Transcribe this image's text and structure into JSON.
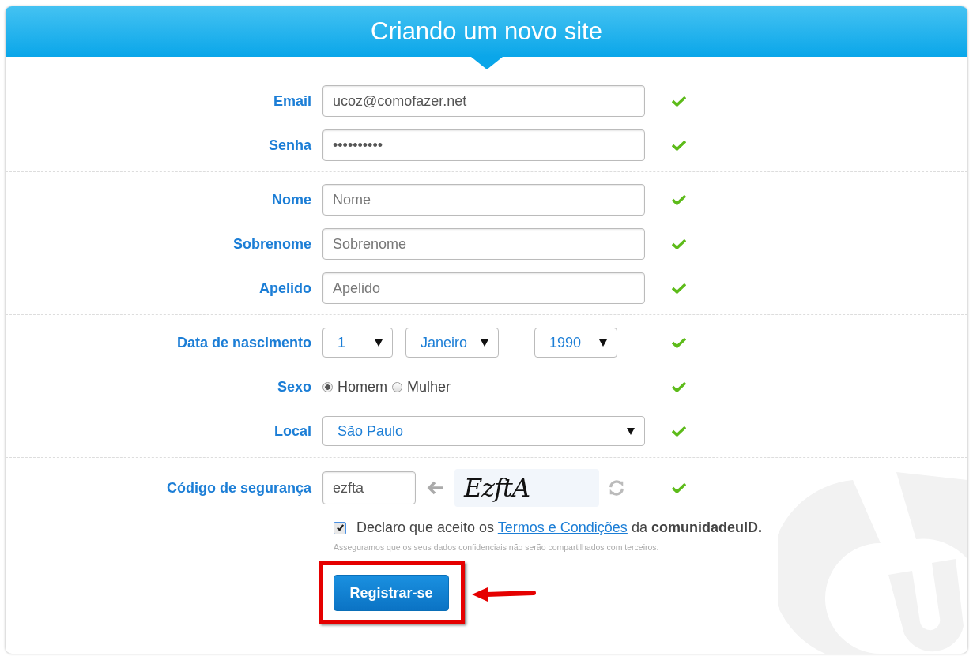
{
  "header": {
    "title": "Criando um novo site"
  },
  "sections": [
    {
      "fields": [
        {
          "kind": "text",
          "label": "Email",
          "value": "ucoz@comofazer.net",
          "valid": true
        },
        {
          "kind": "text",
          "label": "Senha",
          "value": "••••••••••",
          "valid": true
        }
      ]
    },
    {
      "fields": [
        {
          "kind": "text",
          "label": "Nome",
          "placeholder": "Nome",
          "valid": true
        },
        {
          "kind": "text",
          "label": "Sobrenome",
          "placeholder": "Sobrenome",
          "valid": true
        },
        {
          "kind": "text",
          "label": "Apelido",
          "placeholder": "Apelido",
          "valid": true
        }
      ]
    },
    {
      "fields": [
        {
          "kind": "date",
          "label": "Data de nascimento",
          "selects": [
            {
              "value": "1"
            },
            {
              "value": "Janeiro"
            },
            {
              "value": "1990"
            }
          ],
          "valid": true
        },
        {
          "kind": "radio",
          "label": "Sexo",
          "options": [
            {
              "label": "Homem",
              "selected": true
            },
            {
              "label": "Mulher",
              "selected": false
            }
          ],
          "valid": true
        },
        {
          "kind": "select",
          "label": "Local",
          "value": "São Paulo",
          "valid": true
        }
      ]
    },
    {
      "fields": [
        {
          "kind": "captcha",
          "label": "Código de segurança",
          "value": "ezfta",
          "captcha_text": "EzftA",
          "valid": true
        }
      ]
    }
  ],
  "terms": {
    "checked": true,
    "text_before": "Declaro que aceito os",
    "link": "Termos e Condições",
    "text_after": "da **comunidadeuID.**",
    "note": "Asseguramos que os seus dados confidenciais não serão compartilhados com terceiros."
  },
  "submit": {
    "label": "Registrar-se"
  }
}
